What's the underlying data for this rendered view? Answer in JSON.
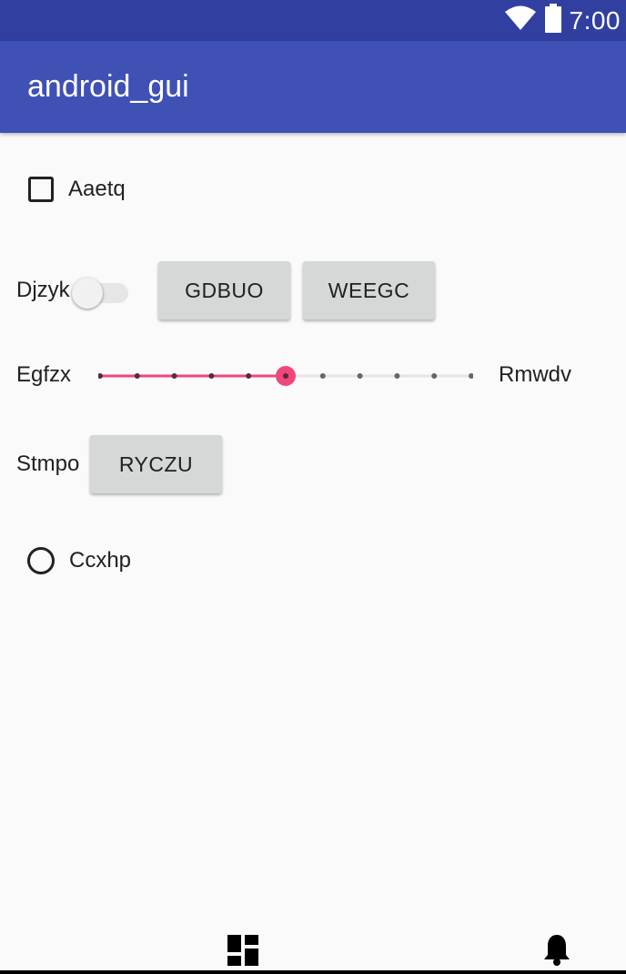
{
  "status_bar": {
    "time": "7:00",
    "icons": [
      "wifi-icon",
      "battery-icon"
    ],
    "background": "#3140a0"
  },
  "app_bar": {
    "title": "android_gui",
    "background": "#3f51b5"
  },
  "widgets": {
    "checkbox": {
      "label": "Aaetq",
      "checked": false
    },
    "switch": {
      "label": "Djzyk",
      "on": false
    },
    "buttons_row1": [
      "GDBUO",
      "WEEGC"
    ],
    "slider": {
      "left_label": "Egfzx",
      "right_label": "Rmwdv",
      "steps": 10,
      "value": 5,
      "accent": "#f0467b"
    },
    "stmpo": {
      "label": "Stmpo",
      "button": "RYCZU"
    },
    "radio": {
      "label": "Ccxhp",
      "selected": false
    }
  },
  "bottom_bar": {
    "icons": [
      "dashboard-icon",
      "notification-bell-icon"
    ]
  }
}
